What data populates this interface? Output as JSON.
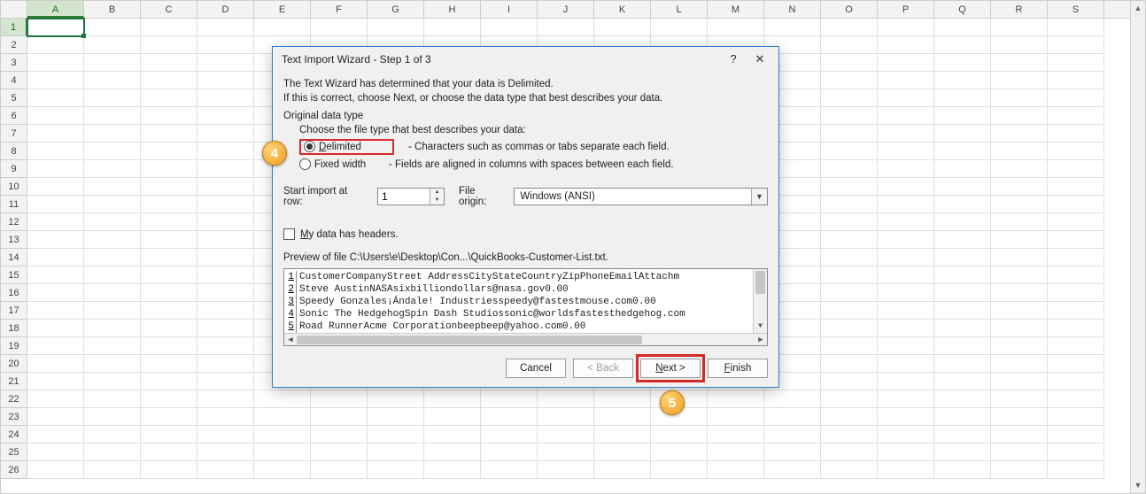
{
  "grid": {
    "columns": [
      "A",
      "B",
      "C",
      "D",
      "E",
      "F",
      "G",
      "H",
      "I",
      "J",
      "K",
      "L",
      "M",
      "N",
      "O",
      "P",
      "Q",
      "R",
      "S"
    ],
    "row_count": 26,
    "selected_col": "A",
    "selected_row": 1
  },
  "dialog": {
    "title": "Text Import Wizard - Step 1 of 3",
    "help_icon": "?",
    "intro1": "The Text Wizard has determined that your data is Delimited.",
    "intro2": "If this is correct, choose Next, or choose the data type that best describes your data.",
    "groupbox_label": "Original data type",
    "choose_label": "Choose the file type that best describes your data:",
    "radios": {
      "delimited": {
        "label": "Delimited",
        "desc": "- Characters such as commas or tabs separate each field.",
        "checked": true
      },
      "fixed": {
        "label": "Fixed width",
        "desc": "- Fields are aligned in columns with spaces between each field.",
        "checked": false
      }
    },
    "start_row_label": "Start import at row:",
    "start_row_value": "1",
    "file_origin_label": "File origin:",
    "file_origin_value": "Windows (ANSI)",
    "headers_checkbox_label": "My data has headers.",
    "headers_checked": false,
    "preview_label": "Preview of file C:\\Users\\e\\Desktop\\Con...\\QuickBooks-Customer-List.txt.",
    "preview_lines": [
      {
        "n": "1",
        "text": "CustomerCompanyStreet AddressCityStateCountryZipPhoneEmailAttachm"
      },
      {
        "n": "2",
        "text": "Steve AustinNASAsixbilliondollars@nasa.gov0.00"
      },
      {
        "n": "3",
        "text": "Speedy Gonzales¡Ándale! Industriesspeedy@fastestmouse.com0.00"
      },
      {
        "n": "4",
        "text": "Sonic The HedgehogSpin Dash Studiossonic@worldsfastesthedgehog.com"
      },
      {
        "n": "5",
        "text": "Road RunnerAcme Corporationbeepbeep@yahoo.com0.00"
      }
    ],
    "buttons": {
      "cancel": "Cancel",
      "back": "< Back",
      "next": "Next >",
      "finish": "Finish"
    }
  },
  "callouts": {
    "b4": "4",
    "b5": "5"
  }
}
